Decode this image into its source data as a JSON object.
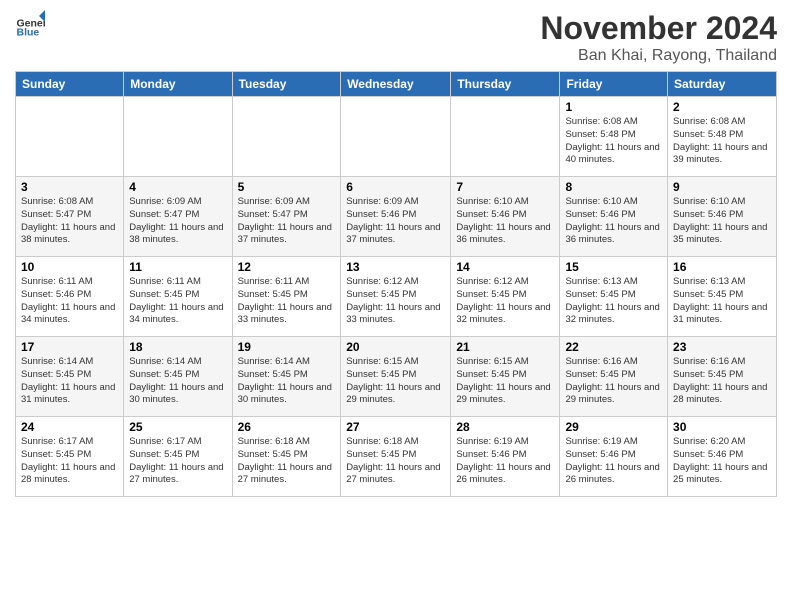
{
  "logo": {
    "general": "General",
    "blue": "Blue"
  },
  "title": "November 2024",
  "location": "Ban Khai, Rayong, Thailand",
  "days_of_week": [
    "Sunday",
    "Monday",
    "Tuesday",
    "Wednesday",
    "Thursday",
    "Friday",
    "Saturday"
  ],
  "weeks": [
    [
      {
        "day": "",
        "info": ""
      },
      {
        "day": "",
        "info": ""
      },
      {
        "day": "",
        "info": ""
      },
      {
        "day": "",
        "info": ""
      },
      {
        "day": "",
        "info": ""
      },
      {
        "day": "1",
        "info": "Sunrise: 6:08 AM\nSunset: 5:48 PM\nDaylight: 11 hours\nand 40 minutes."
      },
      {
        "day": "2",
        "info": "Sunrise: 6:08 AM\nSunset: 5:48 PM\nDaylight: 11 hours\nand 39 minutes."
      }
    ],
    [
      {
        "day": "3",
        "info": "Sunrise: 6:08 AM\nSunset: 5:47 PM\nDaylight: 11 hours\nand 38 minutes."
      },
      {
        "day": "4",
        "info": "Sunrise: 6:09 AM\nSunset: 5:47 PM\nDaylight: 11 hours\nand 38 minutes."
      },
      {
        "day": "5",
        "info": "Sunrise: 6:09 AM\nSunset: 5:47 PM\nDaylight: 11 hours\nand 37 minutes."
      },
      {
        "day": "6",
        "info": "Sunrise: 6:09 AM\nSunset: 5:46 PM\nDaylight: 11 hours\nand 37 minutes."
      },
      {
        "day": "7",
        "info": "Sunrise: 6:10 AM\nSunset: 5:46 PM\nDaylight: 11 hours\nand 36 minutes."
      },
      {
        "day": "8",
        "info": "Sunrise: 6:10 AM\nSunset: 5:46 PM\nDaylight: 11 hours\nand 36 minutes."
      },
      {
        "day": "9",
        "info": "Sunrise: 6:10 AM\nSunset: 5:46 PM\nDaylight: 11 hours\nand 35 minutes."
      }
    ],
    [
      {
        "day": "10",
        "info": "Sunrise: 6:11 AM\nSunset: 5:46 PM\nDaylight: 11 hours\nand 34 minutes."
      },
      {
        "day": "11",
        "info": "Sunrise: 6:11 AM\nSunset: 5:45 PM\nDaylight: 11 hours\nand 34 minutes."
      },
      {
        "day": "12",
        "info": "Sunrise: 6:11 AM\nSunset: 5:45 PM\nDaylight: 11 hours\nand 33 minutes."
      },
      {
        "day": "13",
        "info": "Sunrise: 6:12 AM\nSunset: 5:45 PM\nDaylight: 11 hours\nand 33 minutes."
      },
      {
        "day": "14",
        "info": "Sunrise: 6:12 AM\nSunset: 5:45 PM\nDaylight: 11 hours\nand 32 minutes."
      },
      {
        "day": "15",
        "info": "Sunrise: 6:13 AM\nSunset: 5:45 PM\nDaylight: 11 hours\nand 32 minutes."
      },
      {
        "day": "16",
        "info": "Sunrise: 6:13 AM\nSunset: 5:45 PM\nDaylight: 11 hours\nand 31 minutes."
      }
    ],
    [
      {
        "day": "17",
        "info": "Sunrise: 6:14 AM\nSunset: 5:45 PM\nDaylight: 11 hours\nand 31 minutes."
      },
      {
        "day": "18",
        "info": "Sunrise: 6:14 AM\nSunset: 5:45 PM\nDaylight: 11 hours\nand 30 minutes."
      },
      {
        "day": "19",
        "info": "Sunrise: 6:14 AM\nSunset: 5:45 PM\nDaylight: 11 hours\nand 30 minutes."
      },
      {
        "day": "20",
        "info": "Sunrise: 6:15 AM\nSunset: 5:45 PM\nDaylight: 11 hours\nand 29 minutes."
      },
      {
        "day": "21",
        "info": "Sunrise: 6:15 AM\nSunset: 5:45 PM\nDaylight: 11 hours\nand 29 minutes."
      },
      {
        "day": "22",
        "info": "Sunrise: 6:16 AM\nSunset: 5:45 PM\nDaylight: 11 hours\nand 29 minutes."
      },
      {
        "day": "23",
        "info": "Sunrise: 6:16 AM\nSunset: 5:45 PM\nDaylight: 11 hours\nand 28 minutes."
      }
    ],
    [
      {
        "day": "24",
        "info": "Sunrise: 6:17 AM\nSunset: 5:45 PM\nDaylight: 11 hours\nand 28 minutes."
      },
      {
        "day": "25",
        "info": "Sunrise: 6:17 AM\nSunset: 5:45 PM\nDaylight: 11 hours\nand 27 minutes."
      },
      {
        "day": "26",
        "info": "Sunrise: 6:18 AM\nSunset: 5:45 PM\nDaylight: 11 hours\nand 27 minutes."
      },
      {
        "day": "27",
        "info": "Sunrise: 6:18 AM\nSunset: 5:45 PM\nDaylight: 11 hours\nand 27 minutes."
      },
      {
        "day": "28",
        "info": "Sunrise: 6:19 AM\nSunset: 5:46 PM\nDaylight: 11 hours\nand 26 minutes."
      },
      {
        "day": "29",
        "info": "Sunrise: 6:19 AM\nSunset: 5:46 PM\nDaylight: 11 hours\nand 26 minutes."
      },
      {
        "day": "30",
        "info": "Sunrise: 6:20 AM\nSunset: 5:46 PM\nDaylight: 11 hours\nand 25 minutes."
      }
    ]
  ]
}
